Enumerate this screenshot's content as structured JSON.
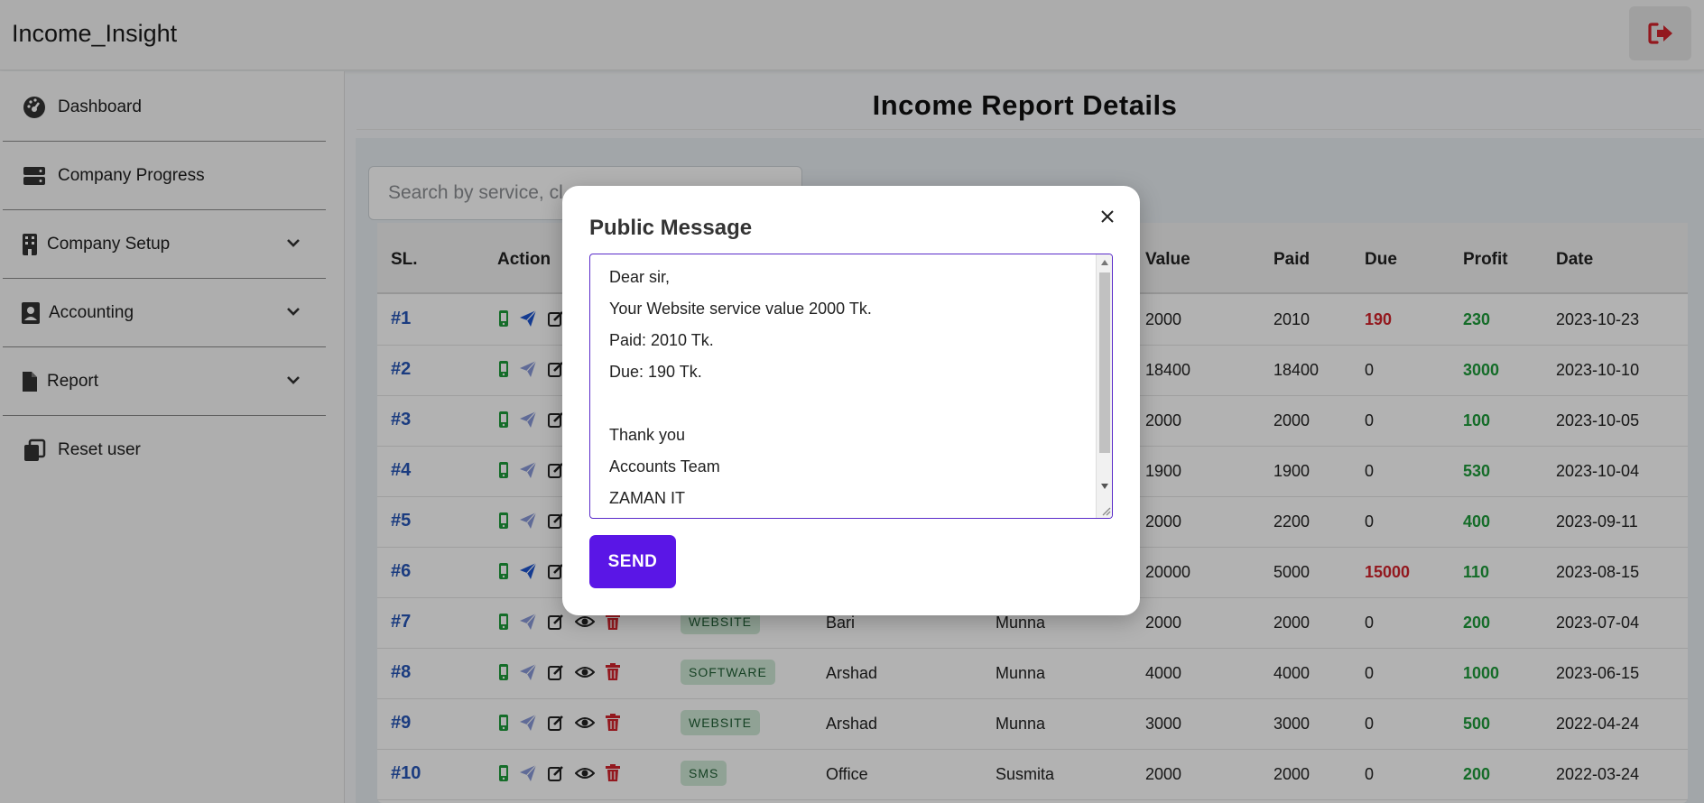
{
  "app": {
    "title": "Income_Insight"
  },
  "sidebar": {
    "items": [
      {
        "label": "Dashboard",
        "icon": "dashboard-gauge-icon",
        "has_chevron": false
      },
      {
        "label": "Company Progress",
        "icon": "server-icon",
        "has_chevron": false
      },
      {
        "label": "Company Setup",
        "icon": "building-icon",
        "has_chevron": true
      },
      {
        "label": "Accounting",
        "icon": "id-badge-icon",
        "has_chevron": true
      },
      {
        "label": "Report",
        "icon": "file-icon",
        "has_chevron": true
      },
      {
        "label": "Reset user",
        "icon": "copy-icon",
        "has_chevron": false
      }
    ]
  },
  "main": {
    "title": "Income Report Details",
    "search_placeholder": "Search by service, cl... name ...",
    "table": {
      "headers": [
        "SL.",
        "Action",
        "Value",
        "Paid",
        "Due",
        "Profit",
        "Date"
      ],
      "rows": [
        {
          "sl": "#1",
          "service": "",
          "client": "",
          "by": "",
          "value": "2000",
          "paid": "2010",
          "due": "190",
          "profit": "230",
          "date": "2023-10-23",
          "send_active": true
        },
        {
          "sl": "#2",
          "service": "",
          "client": "",
          "by": "",
          "value": "18400",
          "paid": "18400",
          "due": "0",
          "profit": "3000",
          "date": "2023-10-10",
          "send_active": false
        },
        {
          "sl": "#3",
          "service": "",
          "client": "",
          "by": "",
          "value": "2000",
          "paid": "2000",
          "due": "0",
          "profit": "100",
          "date": "2023-10-05",
          "send_active": false
        },
        {
          "sl": "#4",
          "service": "",
          "client": "",
          "by": "",
          "value": "1900",
          "paid": "1900",
          "due": "0",
          "profit": "530",
          "date": "2023-10-04",
          "send_active": false
        },
        {
          "sl": "#5",
          "service": "",
          "client": "",
          "by": "",
          "value": "2000",
          "paid": "2200",
          "due": "0",
          "profit": "400",
          "date": "2023-09-11",
          "send_active": false
        },
        {
          "sl": "#6",
          "service": "",
          "client": "",
          "by": "",
          "value": "20000",
          "paid": "5000",
          "due": "15000",
          "profit": "110",
          "date": "2023-08-15",
          "send_active": true
        },
        {
          "sl": "#7",
          "service": "WEBSITE",
          "client": "Bari",
          "by": "Munna",
          "value": "2000",
          "paid": "2000",
          "due": "0",
          "profit": "200",
          "date": "2023-07-04",
          "send_active": false
        },
        {
          "sl": "#8",
          "service": "SOFTWARE",
          "client": "Arshad",
          "by": "Munna",
          "value": "4000",
          "paid": "4000",
          "due": "0",
          "profit": "1000",
          "date": "2023-06-15",
          "send_active": false
        },
        {
          "sl": "#9",
          "service": "WEBSITE",
          "client": "Arshad",
          "by": "Munna",
          "value": "3000",
          "paid": "3000",
          "due": "0",
          "profit": "500",
          "date": "2022-04-24",
          "send_active": false
        },
        {
          "sl": "#10",
          "service": "SMS",
          "client": "Office",
          "by": "Susmita",
          "value": "2000",
          "paid": "2000",
          "due": "0",
          "profit": "200",
          "date": "2022-03-24",
          "send_active": false
        }
      ]
    }
  },
  "modal": {
    "title": "Public Message",
    "message_lines": [
      "Dear sir,",
      "Your Website service value 2000 Tk.",
      "Paid: 2010 Tk.",
      "Due: 190 Tk.",
      "",
      "Thank you",
      "Accounts Team",
      "ZAMAN IT"
    ],
    "send_label": "SEND"
  },
  "colors": {
    "accent": "#5a16e6",
    "link_blue": "#2757b8",
    "due_red": "#d3232b",
    "profit_green": "#1d9b3a",
    "logout_red": "#d3232b"
  }
}
